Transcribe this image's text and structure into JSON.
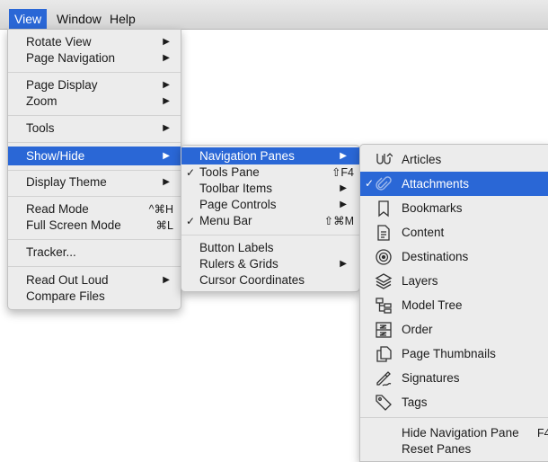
{
  "menubar": {
    "items": [
      "View",
      "Window",
      "Help"
    ]
  },
  "view_menu": {
    "rotate_view": "Rotate View",
    "page_navigation": "Page Navigation",
    "page_display": "Page Display",
    "zoom": "Zoom",
    "tools": "Tools",
    "show_hide": "Show/Hide",
    "display_theme": "Display Theme",
    "read_mode": "Read Mode",
    "read_mode_shortcut": "^⌘H",
    "full_screen_mode": "Full Screen Mode",
    "full_screen_shortcut": "⌘L",
    "tracker": "Tracker...",
    "read_out_loud": "Read Out Loud",
    "compare_files": "Compare Files",
    "arrow": "▶"
  },
  "showhide_menu": {
    "navigation_panes": "Navigation Panes",
    "tools_pane": "Tools Pane",
    "tools_pane_shortcut": "⇧F4",
    "toolbar_items": "Toolbar Items",
    "page_controls": "Page Controls",
    "menu_bar": "Menu Bar",
    "menu_bar_shortcut": "⇧⌘M",
    "button_labels": "Button Labels",
    "rulers_grids": "Rulers & Grids",
    "cursor_coordinates": "Cursor Coordinates",
    "check": "✓",
    "arrow": "▶"
  },
  "navpanes_menu": {
    "articles": "Articles",
    "attachments": "Attachments",
    "bookmarks": "Bookmarks",
    "content": "Content",
    "destinations": "Destinations",
    "layers": "Layers",
    "model_tree": "Model Tree",
    "order": "Order",
    "page_thumbnails": "Page Thumbnails",
    "signatures": "Signatures",
    "tags": "Tags",
    "hide_navigation_pane": "Hide Navigation Pane",
    "hide_navigation_shortcut": "F4",
    "reset_panes": "Reset Panes",
    "check": "✓"
  },
  "colors": {
    "highlight": "#2a67d6",
    "menu_bg": "#ececec"
  }
}
